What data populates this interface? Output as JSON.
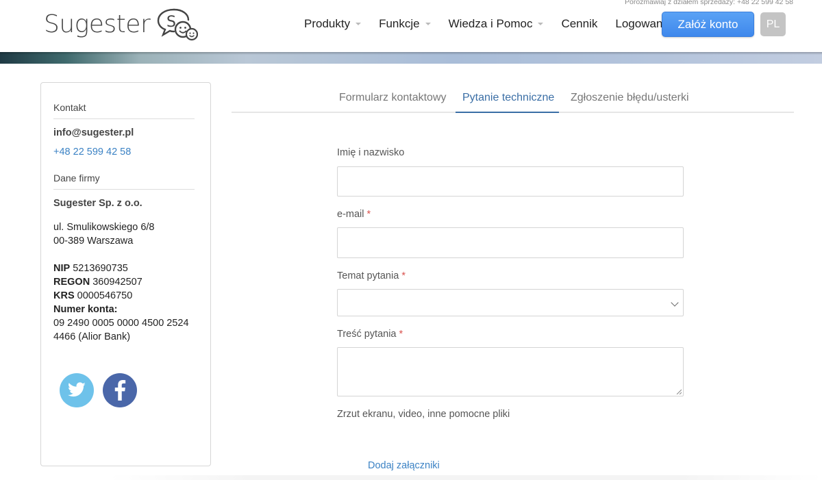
{
  "header": {
    "sales_line": "Porozmawiaj z działem sprzedaży: +48 22 599 42 58",
    "logo_text": "Sugester",
    "nav": [
      {
        "label": "Produkty",
        "has_caret": true
      },
      {
        "label": "Funkcje",
        "has_caret": true
      },
      {
        "label": "Wiedza i Pomoc",
        "has_caret": true
      },
      {
        "label": "Cennik",
        "has_caret": false
      },
      {
        "label": "Logowanie",
        "has_caret": false
      }
    ],
    "signup_button": "Załóż konto",
    "lang_button": "PL"
  },
  "sidebar": {
    "contact_title": "Kontakt",
    "email": "info@sugester.pl",
    "phone": "+48 22 599 42 58",
    "company_title": "Dane firmy",
    "company_name": "Sugester Sp. z o.o.",
    "address_line1": "ul. Smulikowskiego 6/8",
    "address_line2": "00-389 Warszawa",
    "nip_label": "NIP",
    "nip_value": "5213690735",
    "regon_label": "REGON",
    "regon_value": "360942507",
    "krs_label": "KRS",
    "krs_value": "0000546750",
    "account_label": "Numer konta:",
    "account_line1": "09 2490 0005 0000 4500 2524",
    "account_line2": "4466 (Alior Bank)",
    "social": [
      "twitter-icon",
      "facebook-icon"
    ]
  },
  "tabs": [
    {
      "label": "Formularz kontaktowy",
      "active": false
    },
    {
      "label": "Pytanie techniczne",
      "active": true
    },
    {
      "label": "Zgłoszenie błędu/usterki",
      "active": false
    }
  ],
  "form": {
    "name_label": "Imię i nazwisko",
    "name_value": "",
    "email_label": "e-mail",
    "email_value": "",
    "topic_label": "Temat pytania",
    "topic_value": "",
    "content_label": "Treść pytania",
    "content_value": "",
    "files_label": "Zrzut ekranu, video, inne pomocne pliki",
    "attach_link": "Dodaj załączniki",
    "required_mark": "*"
  },
  "colors": {
    "accent": "#3b82c4",
    "tab_active": "#3a6ea5",
    "signup_bg": "#4a93f0",
    "required": "#d9534f",
    "twitter": "#6ec2ea",
    "facebook": "#4a67a9"
  }
}
